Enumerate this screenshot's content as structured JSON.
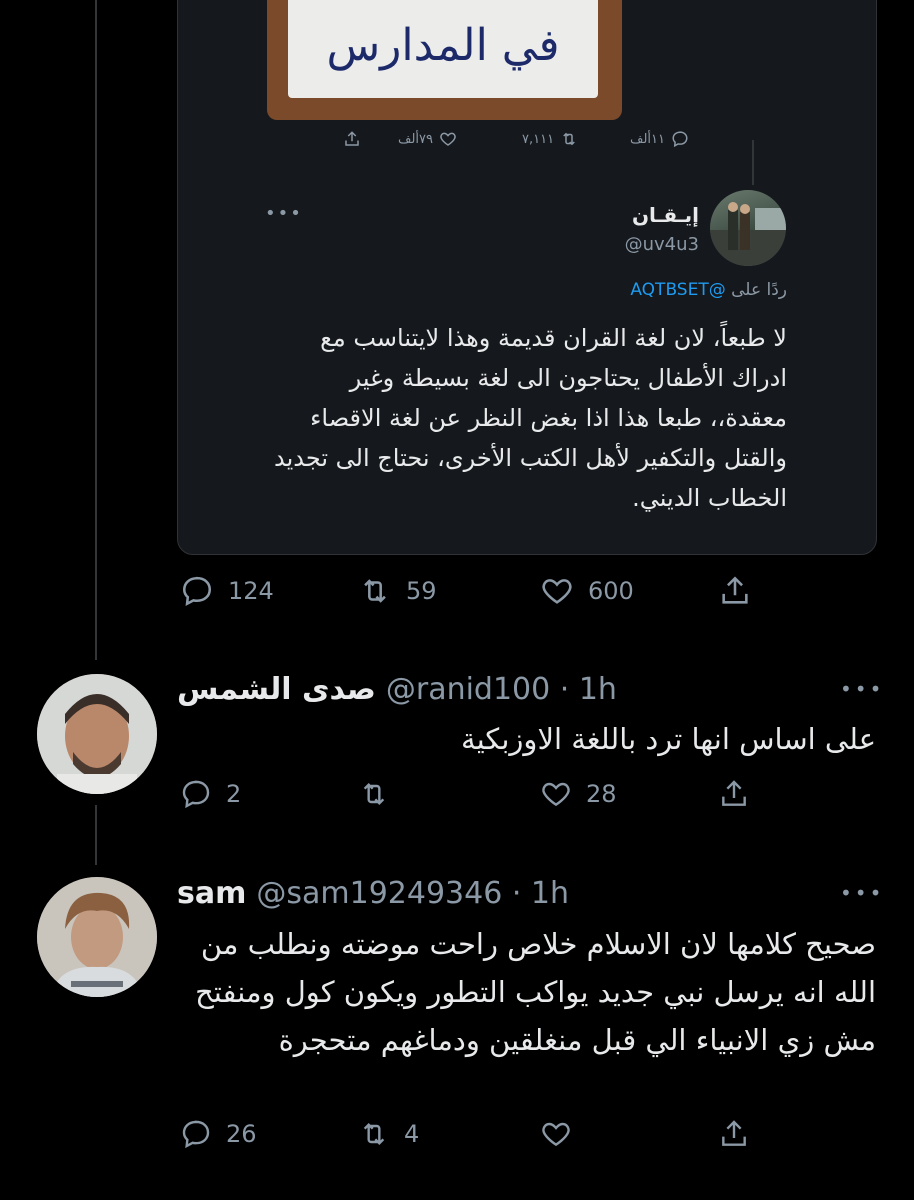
{
  "quoted_image": {
    "visible_text": "في المدارس"
  },
  "quoted_image_actions": {
    "reply_count": "١١ألف",
    "retweet_count": "٧,١١١",
    "like_count": "٧٩ألف"
  },
  "quoted_tweet": {
    "name": "إيـقـان",
    "handle": "@uv4u3",
    "reply_prefix": "ردًا على",
    "reply_mention": "@AQTBSET",
    "body": "لا طبعاً، لان لغة القران قديمة وهذا لايتناسب مع ادراك الأطفال يحتاجون الى لغة بسيطة وغير معقدة،، طبعا هذا اذا بغض النظر عن لغة الاقصاء والقتل والتكفير لأهل الكتب الأخرى، نحتاج الى تجديد الخطاب الديني."
  },
  "main_actions": {
    "reply_count": "124",
    "retweet_count": "59",
    "like_count": "600"
  },
  "reply1": {
    "name": "صدى الشمس",
    "handle_time": "@ranid100 · 1h",
    "body": "على اساس انها ترد باللغة الاوزبكية",
    "reply_count": "2",
    "retweet_count": "",
    "like_count": "28"
  },
  "reply2": {
    "name": "sam",
    "handle_time": "@sam19249346 · 1h",
    "body": "صحيح كلامها لان الاسلام خلاص راحت موضته ونطلب من الله انه يرسل نبي جديد يواكب التطور ويكون كول ومنفتح مش زي الانبياء الي قبل منغلقين ودماغهم متحجرة",
    "reply_count": "26",
    "retweet_count": "4",
    "like_count": ""
  },
  "icons": {
    "reply": "reply-icon",
    "retweet": "retweet-icon",
    "like": "heart-icon",
    "share": "share-icon",
    "more": "more-icon"
  },
  "colors": {
    "background": "#000000",
    "card": "#15181c",
    "muted": "#8b98a5",
    "link": "#1d9bf0"
  }
}
